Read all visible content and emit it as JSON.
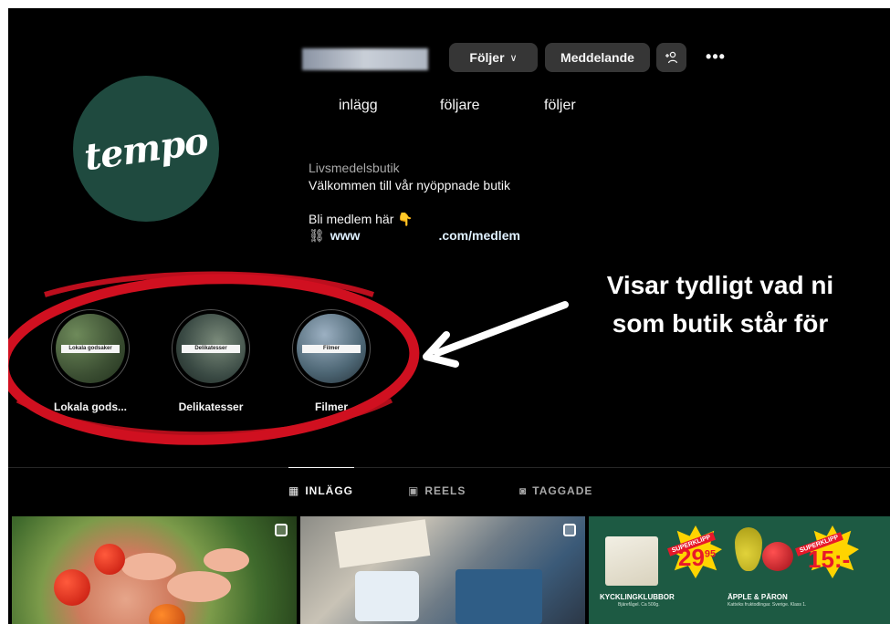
{
  "profile": {
    "logo_text": "tempo",
    "buttons": {
      "follow": "Följer",
      "message": "Meddelande"
    },
    "stats": {
      "posts": "inlägg",
      "followers": "följare",
      "following": "följer"
    },
    "bio": {
      "category": "Livsmedelsbutik",
      "line1": "Välkommen till vår nyöppnade butik",
      "line2": "Bli medlem här 👇",
      "link_start": "www",
      "link_end": ".com/medlem"
    }
  },
  "highlights": [
    {
      "label": "Lokala gods...",
      "tag": "Lokala godsaker"
    },
    {
      "label": "Delikatesser",
      "tag": "Delikatesser"
    },
    {
      "label": "Filmer",
      "tag": "Filmer"
    }
  ],
  "annotation": {
    "line1": "Visar tydligt vad ni",
    "line2": "som butik står för"
  },
  "tabs": {
    "posts": "INLÄGG",
    "reels": "REELS",
    "tagged": "TAGGADE"
  },
  "posts": {
    "flyer": {
      "badge": "SUPERKLIPP",
      "price1": "29",
      "price1_cents": "95",
      "price2": "15:-",
      "item1": "KYCKLINGKLUBBOR",
      "item1_sub": "Bjärefågel. Ca 500g.",
      "item2": "ÄPPLE & PÄRON",
      "item2_sub": "Kattviks fruktodlingar. Sverige. Klass 1."
    }
  },
  "colors": {
    "background": "#000000",
    "button": "#363636",
    "brand_green": "#1f4a3f",
    "annotation_red": "#d01020"
  }
}
